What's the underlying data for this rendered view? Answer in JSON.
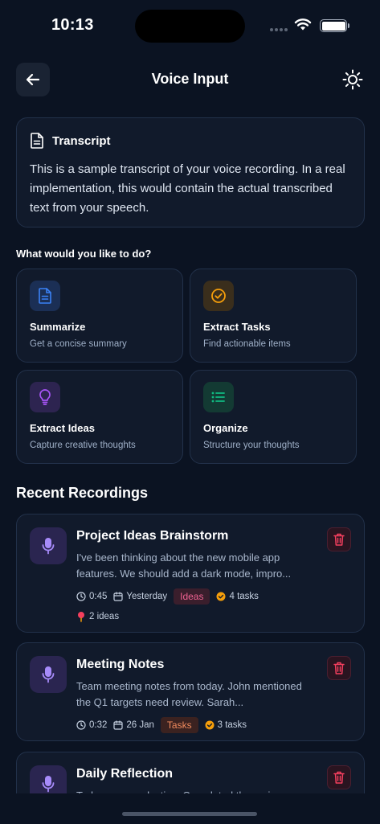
{
  "status": {
    "time": "10:13"
  },
  "header": {
    "title": "Voice Input"
  },
  "transcript": {
    "title": "Transcript",
    "text": "This is a sample transcript of your voice recording. In a real implementation, this would contain the actual transcribed text from your speech."
  },
  "question": "What would you like to do?",
  "actions": [
    {
      "title": "Summarize",
      "subtitle": "Get a concise summary",
      "icon": "document-icon",
      "color": "#3b82f6"
    },
    {
      "title": "Extract Tasks",
      "subtitle": "Find actionable items",
      "icon": "check-circle-icon",
      "color": "#f59e0b"
    },
    {
      "title": "Extract Ideas",
      "subtitle": "Capture creative thoughts",
      "icon": "lightbulb-icon",
      "color": "#a855f7"
    },
    {
      "title": "Organize",
      "subtitle": "Structure your thoughts",
      "icon": "list-icon",
      "color": "#10b981"
    }
  ],
  "recent": {
    "title": "Recent Recordings",
    "items": [
      {
        "title": "Project Ideas Brainstorm",
        "preview": "I've been thinking about the new mobile app features. We should add a dark mode, impro...",
        "duration": "0:45",
        "date": "Yesterday",
        "tag": "Ideas",
        "tasks": "4 tasks",
        "ideas": "2 ideas"
      },
      {
        "title": "Meeting Notes",
        "preview": "Team meeting notes from today. John mentioned the Q1 targets need review. Sarah...",
        "duration": "0:32",
        "date": "26 Jan",
        "tag": "Tasks",
        "tasks": "3 tasks"
      },
      {
        "title": "Daily Reflection",
        "preview": "Today was productive. Completed the main..."
      }
    ]
  },
  "colors": {
    "background": "#0b1322",
    "card": "#111a2b",
    "mic_accent": "#a78bfa",
    "delete": "#f43f5e"
  }
}
